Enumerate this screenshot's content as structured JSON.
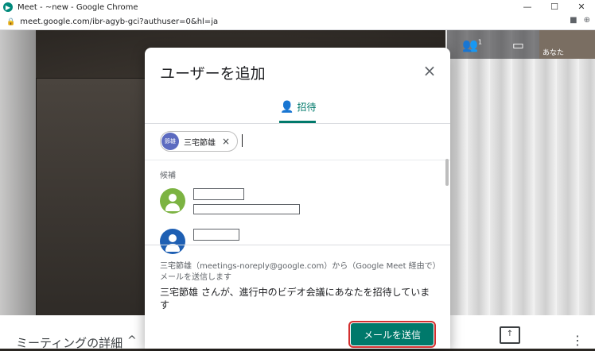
{
  "window": {
    "title": "Meet - ~new - Google Chrome",
    "controls": [
      "—",
      "☐",
      "✕"
    ]
  },
  "address": {
    "url": "meet.google.com/ibr-agyb-gci?authuser=0&hl=ja"
  },
  "topbar": {
    "participants_count": "1",
    "self_label": "あなた"
  },
  "bottombar": {
    "details_label": "ミーティングの詳細",
    "chevron": "^"
  },
  "dialog": {
    "title": "ユーザーを追加",
    "close": "×",
    "tab_invite_label": "招待",
    "chip": {
      "avatar_text": "節雄",
      "name": "三宅節雄",
      "remove": "×"
    },
    "suggestions_label": "候補",
    "info_line": "三宅節雄（meetings-noreply@google.com）から（Google Meet 経由で）メールを送信します",
    "message": "三宅節雄 さんが、進行中のビデオ会議にあなたを招待しています",
    "send_button": "メールを送信"
  },
  "colors": {
    "accent": "#00796b",
    "highlight_outline": "#d32f2f",
    "chip_avatar": "#5c6bc0"
  }
}
